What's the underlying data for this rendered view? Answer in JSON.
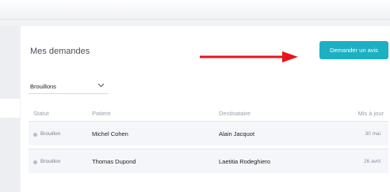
{
  "page": {
    "title": "Mes demandes",
    "primary_button": "Demander un avis",
    "accent_color": "#1cb0c2",
    "arrow_color": "#e8141c"
  },
  "filter": {
    "selected": "Brouillons"
  },
  "table": {
    "headers": [
      "Statut",
      "Patient",
      "Destinataire",
      "Mis à jour"
    ],
    "rows": [
      {
        "statut": "Brouillon",
        "patient": "Michel Cohen",
        "destinataire": "Alain Jacquot",
        "date": "30 mai"
      },
      {
        "statut": "Brouillon",
        "patient": "Thomas Dupond",
        "destinataire": "Laetitia Rodeghiero",
        "date": "26 avril"
      }
    ]
  }
}
